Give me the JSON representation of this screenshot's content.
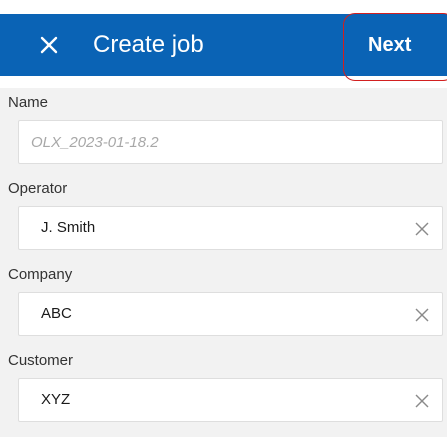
{
  "header": {
    "title": "Create job",
    "next_label": "Next"
  },
  "fields": {
    "name": {
      "label": "Name",
      "placeholder": "OLX_2023-01-18.2"
    },
    "operator": {
      "label": "Operator",
      "value": "J. Smith"
    },
    "company": {
      "label": "Company",
      "value": "ABC"
    },
    "customer": {
      "label": "Customer",
      "value": "XYZ"
    }
  },
  "icons": {
    "close": "close-icon",
    "clear": "clear-icon"
  },
  "colors": {
    "header_bg": "#0a63b5",
    "highlight": "#d21f1f",
    "page_bg": "#f2f2f2"
  }
}
